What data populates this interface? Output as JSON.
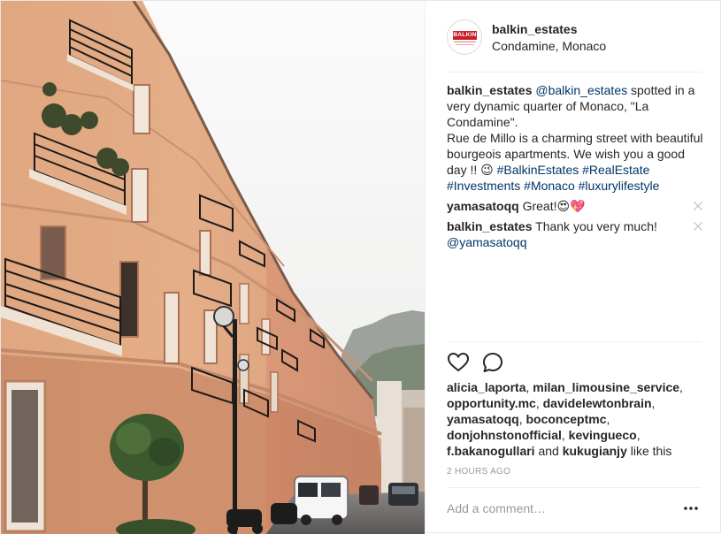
{
  "post": {
    "username": "balkin_estates",
    "location": "Condamine, Monaco",
    "avatar_logo_text": "BALKIN",
    "caption": {
      "author": "balkin_estates",
      "mention": "@balkin_estates",
      "text_1": " spotted in a very dynamic quarter of Monaco, \"La Condamine\".",
      "text_2": "Rue de Millo is a charming street with beautiful bourgeois apartments. We wish you a good day !! 😉 ",
      "tags": [
        "#BalkinEstates",
        "#RealEstate",
        "#Investments",
        "#Monaco",
        "#luxurylifestyle"
      ]
    },
    "comments": [
      {
        "author": "yamasatoqq",
        "text": "Great!😍💖"
      },
      {
        "author": "balkin_estates",
        "text": "Thank you very much!",
        "mention": "@yamasatoqq"
      }
    ],
    "likers": [
      "alicia_laporta",
      "milan_limousine_service",
      "opportunity.mc",
      "davidelewtonbrain",
      "yamasatoqq",
      "boconceptmc",
      "donjohnstonofficial",
      "kevingueco",
      "f.bakanogullari",
      "kukugianjy"
    ],
    "likes_and": " and ",
    "likes_suffix": " like this",
    "timestamp": "2 HOURS AGO",
    "add_comment_placeholder": "Add a comment…"
  },
  "icons": {
    "like": "heart-outline-icon",
    "comment": "speech-bubble-icon",
    "remove": "close-x-icon",
    "more": "ellipsis-icon"
  },
  "colors": {
    "text": "#262626",
    "link": "#003569",
    "muted": "#999999",
    "border": "#efefef",
    "brand_red": "#c8202a"
  }
}
